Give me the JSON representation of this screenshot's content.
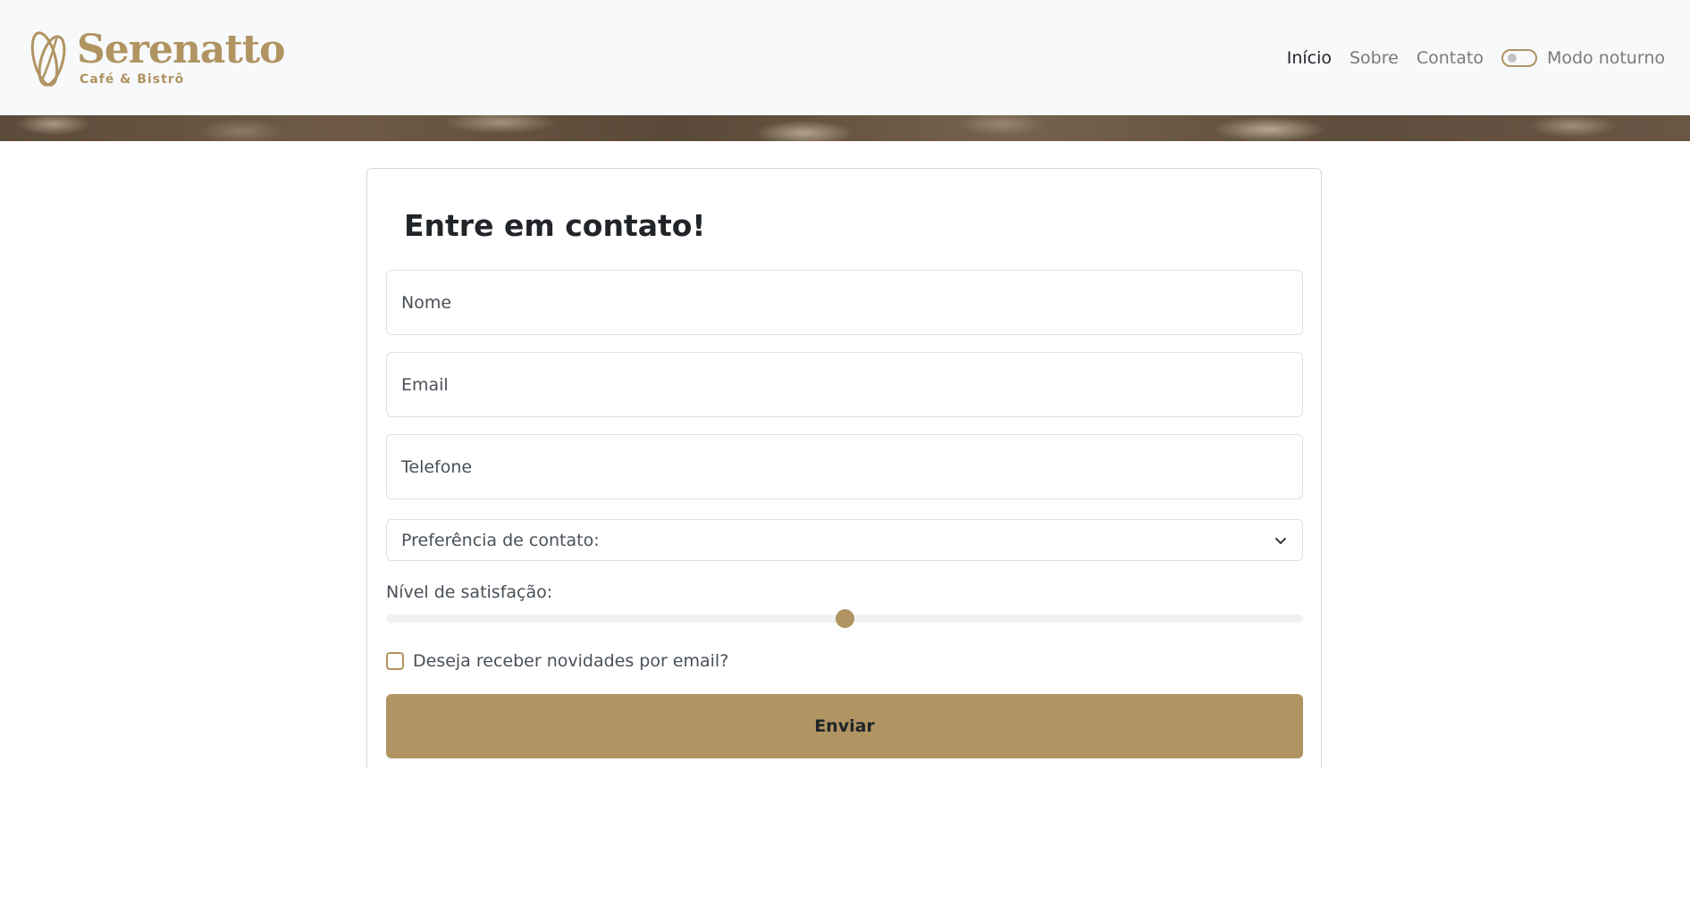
{
  "brand": {
    "name": "Serenatto",
    "tagline": "Café & Bistrô",
    "color": "#b09462"
  },
  "nav": {
    "items": [
      {
        "label": "Início",
        "active": true
      },
      {
        "label": "Sobre",
        "active": false
      },
      {
        "label": "Contato",
        "active": false
      }
    ],
    "dark_mode": {
      "label": "Modo noturno",
      "enabled": false
    }
  },
  "form": {
    "title": "Entre em contato!",
    "name_placeholder": "Nome",
    "email_placeholder": "Email",
    "phone_placeholder": "Telefone",
    "contact_preference": {
      "selected": "Preferência de contato:"
    },
    "satisfaction": {
      "label": "Nível de satisfação:",
      "value": 50,
      "min": 0,
      "max": 100
    },
    "newsletter": {
      "label": "Deseja receber novidades por email?",
      "checked": false
    },
    "submit_label": "Enviar"
  },
  "colors": {
    "accent": "#b09462",
    "header_bg": "#f8f9fa"
  }
}
